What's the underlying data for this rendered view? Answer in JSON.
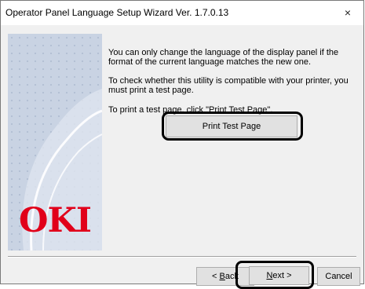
{
  "window": {
    "title": "Operator Panel Language Setup Wizard Ver. 1.7.0.13",
    "close_glyph": "×"
  },
  "sidebar": {
    "logo_text": "OKI",
    "logo_color": "#e1001a"
  },
  "body": {
    "paragraph1": "You can only change the language of the display panel if the format of the current language matches the new one.",
    "paragraph2": "To check whether this utility is compatible with your printer, you must print a test page.",
    "paragraph3": "To print a test page, click \"Print Test Page\"."
  },
  "buttons": {
    "print_test_page": "Print Test Page",
    "back_prefix": "< ",
    "back_accel": "B",
    "back_rest": "ack",
    "next_accel": "N",
    "next_rest": "ext >",
    "cancel": "Cancel"
  }
}
